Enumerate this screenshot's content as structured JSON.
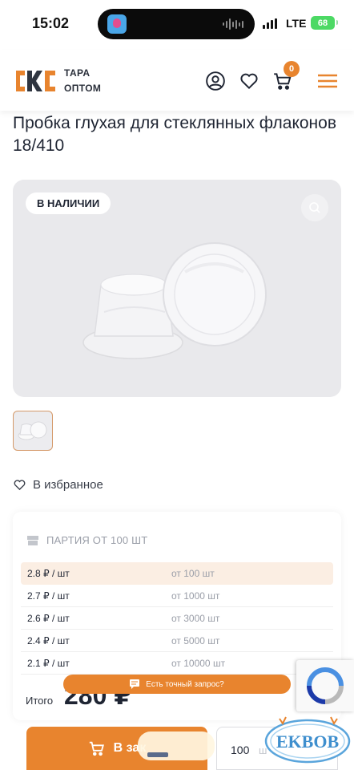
{
  "status_bar": {
    "time": "15:02",
    "network": "LTE",
    "battery": "68"
  },
  "header": {
    "logo_line1": "ТАРА",
    "logo_line2": "ОПТОМ",
    "cart_count": "0",
    "accent_color": "#e8842e"
  },
  "product": {
    "title": "Пробка глухая для стеклянных флаконов 18/410",
    "stock_badge": "В НАЛИЧИИ",
    "favorite_label": "В избранное"
  },
  "pricing": {
    "batch_label": "ПАРТИЯ ОТ 100 ШТ",
    "tiers": [
      {
        "price": "2.8 ₽ / шт",
        "from": "от 100 шт"
      },
      {
        "price": "2.7 ₽ / шт",
        "from": "от 1000 шт"
      },
      {
        "price": "2.6 ₽ / шт",
        "from": "от 3000 шт"
      },
      {
        "price": "2.4 ₽ / шт",
        "from": "от 5000 шт"
      },
      {
        "price": "2.1 ₽ / шт",
        "from": "от 10000 шт"
      }
    ],
    "total_label": "Итого",
    "total_value": "280 ₽"
  },
  "request_banner": "Есть точный запрос?",
  "order": {
    "button_label": "В зак",
    "quantity": "100",
    "quantity_unit": "ш"
  },
  "watermark_text": "EKBOB"
}
